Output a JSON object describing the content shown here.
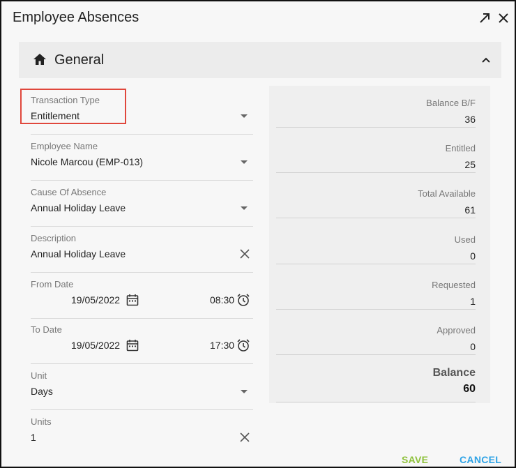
{
  "dialog": {
    "title": "Employee Absences"
  },
  "section": {
    "label": "General"
  },
  "form": {
    "transaction_type": {
      "label": "Transaction Type",
      "value": "Entitlement"
    },
    "employee_name": {
      "label": "Employee Name",
      "value": "Nicole Marcou (EMP-013)"
    },
    "cause_of_absence": {
      "label": "Cause Of Absence",
      "value": "Annual Holiday Leave"
    },
    "description": {
      "label": "Description",
      "value": "Annual Holiday Leave"
    },
    "from_date": {
      "label": "From Date",
      "date": "19/05/2022",
      "time": "08:30"
    },
    "to_date": {
      "label": "To Date",
      "date": "19/05/2022",
      "time": "17:30"
    },
    "unit": {
      "label": "Unit",
      "value": "Days"
    },
    "units": {
      "label": "Units",
      "value": "1"
    }
  },
  "summary": {
    "balance_bf": {
      "label": "Balance B/F",
      "value": "36"
    },
    "entitled": {
      "label": "Entitled",
      "value": "25"
    },
    "total_available": {
      "label": "Total Available",
      "value": "61"
    },
    "used": {
      "label": "Used",
      "value": "0"
    },
    "requested": {
      "label": "Requested",
      "value": "1"
    },
    "approved": {
      "label": "Approved",
      "value": "0"
    },
    "balance": {
      "label": "Balance",
      "value": "60"
    }
  },
  "actions": {
    "save": "SAVE",
    "cancel": "CANCEL"
  },
  "icons": {
    "expand": "expand-arrow-icon",
    "close": "close-icon",
    "home": "home-icon",
    "collapse": "chevron-up-icon",
    "dropdown": "caret-down-icon",
    "clear": "clear-x-icon",
    "calendar": "calendar-icon",
    "clock": "alarm-clock-icon"
  },
  "colors": {
    "highlight": "#e0473c",
    "save": "#8ec13b",
    "cancel": "#2ea3e6"
  }
}
